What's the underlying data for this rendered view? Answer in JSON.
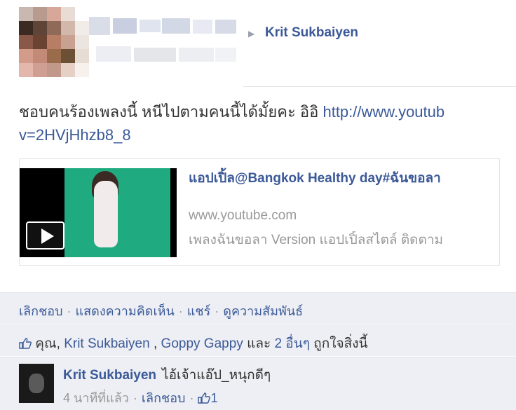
{
  "post": {
    "author": "Krit Sukbaiyen",
    "message": "ชอบคนร้องเพลงนี้ หนีไปตามคนนี้ได้มั้ยคะ อิอิ ",
    "link_line1": "http://www.youtub",
    "link_line2": "v=2HVjHhzb8_8"
  },
  "link_card": {
    "title": "แอปเปิ้ล@Bangkok Healthy day#ฉันขอลา",
    "domain": "www.youtube.com",
    "description": "เพลงฉันขอลา Version แอปเปิ้ลสไตล์ ติดตาม",
    "play_icon": "play-icon"
  },
  "actions": {
    "unlike": "เลิกชอบ",
    "comment": "แสดงความคิดเห็น",
    "share": "แชร์",
    "view_relationship": "ดูความสัมพันธ์",
    "separator": "·"
  },
  "likes": {
    "you": "คุณ",
    "comma": ", ",
    "person1": "Krit Sukbaiyen",
    "sep": " , ",
    "person2": "Goppy Gappy",
    "and": " และ ",
    "others": "2 อื่นๆ",
    "suffix": " ถูกใจสิ่งนี้"
  },
  "comment": {
    "author": "Krit Sukbaiyen",
    "text": "ไอ้เจ้าแอ๊ป_หนุกดีๆ",
    "time": "4 นาทีที่แล้ว",
    "unlike": "เลิกชอบ",
    "like_count": "1"
  },
  "colors": {
    "link": "#3b5998",
    "panel": "#edeff4"
  }
}
